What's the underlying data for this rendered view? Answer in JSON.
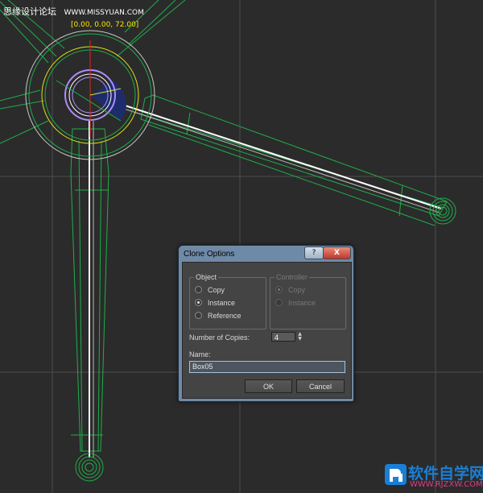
{
  "watermark_top": {
    "text": "思缘设计论坛",
    "url": "WWW.MISSYUAN.COM"
  },
  "viewport": {
    "coordinate_readout": "[0.00, 0.00, 72.00]"
  },
  "dialog": {
    "title": "Clone Options",
    "help_label": "?",
    "close_label": "X",
    "object_group": {
      "title": "Object",
      "options": [
        {
          "label": "Copy",
          "selected": false
        },
        {
          "label": "Instance",
          "selected": true
        },
        {
          "label": "Reference",
          "selected": false
        }
      ]
    },
    "controller_group": {
      "title": "Controller",
      "enabled": false,
      "options": [
        {
          "label": "Copy",
          "selected": true
        },
        {
          "label": "Instance",
          "selected": false
        }
      ]
    },
    "copies_label": "Number of Copies:",
    "copies_value": "4",
    "name_label": "Name:",
    "name_value": "Box05",
    "ok_label": "OK",
    "cancel_label": "Cancel"
  },
  "watermark_bottom": {
    "brand": "软件自学网",
    "site": "WWW.RJZXW.COM"
  },
  "colors": {
    "viewport_bg": "#2b2b2b",
    "wireframe": "#1fae4a",
    "selected_wire": "#ffffff",
    "gizmo_yellow": "#e3e314",
    "gizmo_purple": "#b08cff",
    "coord_text": "#ffe600",
    "dialog_frame": "#6f8aa6"
  },
  "icons": [
    "help-icon",
    "close-icon",
    "spinner-arrows-icon",
    "radio-icon"
  ]
}
